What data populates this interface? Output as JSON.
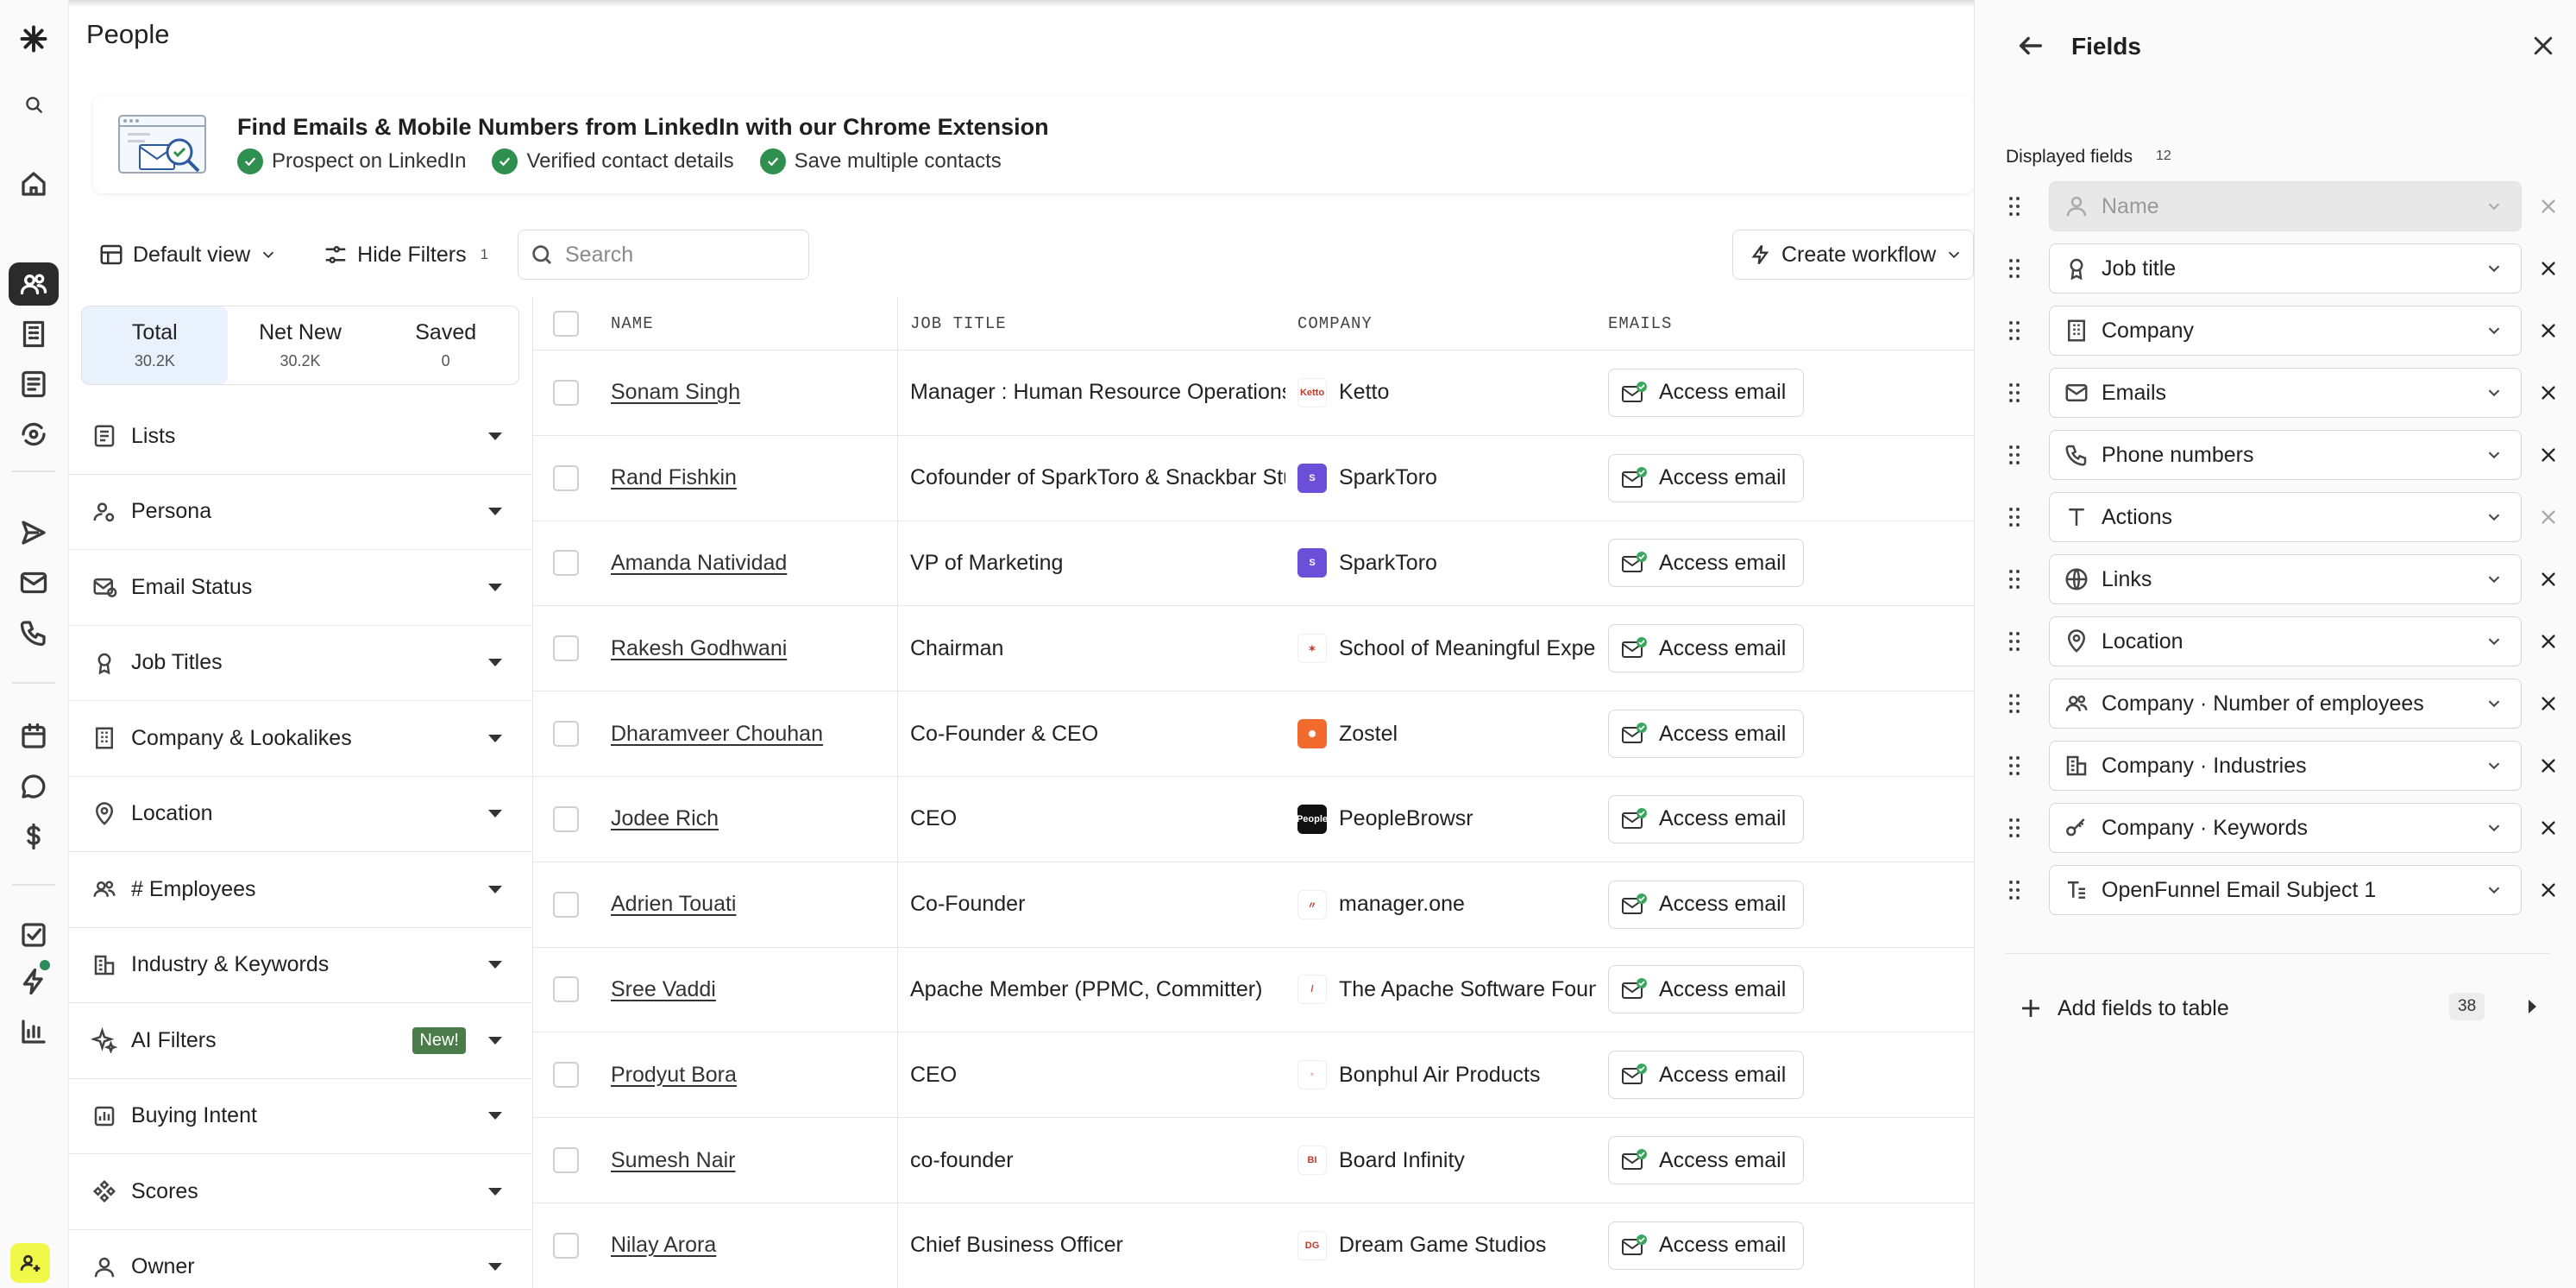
{
  "page": {
    "title": "People"
  },
  "rail": {
    "icons": [
      "logo-icon",
      "search-icon",
      "home-icon",
      "people-icon",
      "building-icon",
      "list-icon",
      "refresh-eye-icon",
      "send-icon",
      "mail-icon",
      "phone-icon",
      "calendar-icon",
      "chat-icon",
      "dollar-icon",
      "tasks-icon",
      "bolt-icon",
      "chart-icon",
      "add-user-icon"
    ]
  },
  "banner": {
    "title": "Find Emails & Mobile Numbers from LinkedIn with our Chrome Extension",
    "bullets": [
      "Prospect on LinkedIn",
      "Verified contact details",
      "Save multiple contacts"
    ]
  },
  "toolbar": {
    "view_label": "Default view",
    "hide_filters_label": "Hide Filters",
    "hide_filters_count": "1",
    "search_placeholder": "Search",
    "create_workflow_label": "Create workflow"
  },
  "summary_tabs": [
    {
      "label": "Total",
      "value": "30.2K"
    },
    {
      "label": "Net New",
      "value": "30.2K"
    },
    {
      "label": "Saved",
      "value": "0"
    }
  ],
  "filters": [
    {
      "label": "Lists",
      "icon": "list-icon"
    },
    {
      "label": "Persona",
      "icon": "persona-icon"
    },
    {
      "label": "Email Status",
      "icon": "email-status-icon"
    },
    {
      "label": "Job Titles",
      "icon": "badge-icon"
    },
    {
      "label": "Company & Lookalikes",
      "icon": "building-icon"
    },
    {
      "label": "Location",
      "icon": "pin-icon"
    },
    {
      "label": "# Employees",
      "icon": "people-icon"
    },
    {
      "label": "Industry & Keywords",
      "icon": "industry-icon"
    },
    {
      "label": "AI Filters",
      "icon": "sparkle-icon",
      "badge": "New!"
    },
    {
      "label": "Buying Intent",
      "icon": "bar-icon"
    },
    {
      "label": "Scores",
      "icon": "scores-icon"
    },
    {
      "label": "Owner",
      "icon": "person-icon"
    }
  ],
  "table": {
    "columns": [
      "NAME",
      "JOB TITLE",
      "COMPANY",
      "EMAILS"
    ],
    "access_label": "Access email",
    "rows": [
      {
        "name": "Sonam Singh",
        "job": "Manager : Human Resource Operations",
        "company": "Ketto",
        "logo_color": "#ffffff",
        "logo_text": "Ketto"
      },
      {
        "name": "Rand Fishkin",
        "job": "Cofounder of SparkToro & Snackbar Studio",
        "company": "SparkToro",
        "logo_color": "#6b4fd8",
        "logo_text": "S"
      },
      {
        "name": "Amanda Natividad",
        "job": "VP of Marketing",
        "company": "SparkToro",
        "logo_color": "#6b4fd8",
        "logo_text": "S"
      },
      {
        "name": "Rakesh Godhwani",
        "job": "Chairman",
        "company": "School of Meaningful Experiences",
        "logo_color": "#ffffff",
        "logo_text": "✶"
      },
      {
        "name": "Dharamveer Chouhan",
        "job": "Co-Founder & CEO",
        "company": "Zostel",
        "logo_color": "#f26a2e",
        "logo_text": "✺"
      },
      {
        "name": "Jodee Rich",
        "job": "CEO",
        "company": "PeopleBrowsr",
        "logo_color": "#111111",
        "logo_text": "People"
      },
      {
        "name": "Adrien Touati",
        "job": "Co-Founder",
        "company": "manager.one",
        "logo_color": "#ffffff",
        "logo_text": "〃"
      },
      {
        "name": "Sree Vaddi",
        "job": "Apache Member (PPMC, Committer)",
        "company": "The Apache Software Foundation",
        "logo_color": "#ffffff",
        "logo_text": "/"
      },
      {
        "name": "Prodyut Bora",
        "job": "CEO",
        "company": "Bonphul Air Products",
        "logo_color": "#ffffff",
        "logo_text": "◦"
      },
      {
        "name": "Sumesh Nair",
        "job": "co-founder",
        "company": "Board Infinity",
        "logo_color": "#ffffff",
        "logo_text": "BI"
      },
      {
        "name": "Nilay Arora",
        "job": "Chief Business Officer",
        "company": "Dream Game Studios",
        "logo_color": "#ffffff",
        "logo_text": "DG"
      }
    ]
  },
  "fields_panel": {
    "title": "Fields",
    "displayed_label": "Displayed fields",
    "displayed_count": "12",
    "fields": [
      {
        "label": "Name",
        "icon": "person-icon",
        "disabled": true
      },
      {
        "label": "Job title",
        "icon": "badge-icon"
      },
      {
        "label": "Company",
        "icon": "building-icon"
      },
      {
        "label": "Emails",
        "icon": "mail-icon"
      },
      {
        "label": "Phone numbers",
        "icon": "phone-icon"
      },
      {
        "label": "Actions",
        "icon": "text-icon",
        "remove_light": true
      },
      {
        "label": "Links",
        "icon": "globe-icon"
      },
      {
        "label": "Location",
        "icon": "pin-icon"
      },
      {
        "label": "Company · Number of employees",
        "icon": "people-icon"
      },
      {
        "label": "Company · Industries",
        "icon": "industry-icon"
      },
      {
        "label": "Company · Keywords",
        "icon": "key-icon"
      },
      {
        "label": "OpenFunnel Email Subject 1",
        "icon": "text-lines-icon"
      }
    ],
    "add_label": "Add fields to table",
    "add_count": "38"
  }
}
